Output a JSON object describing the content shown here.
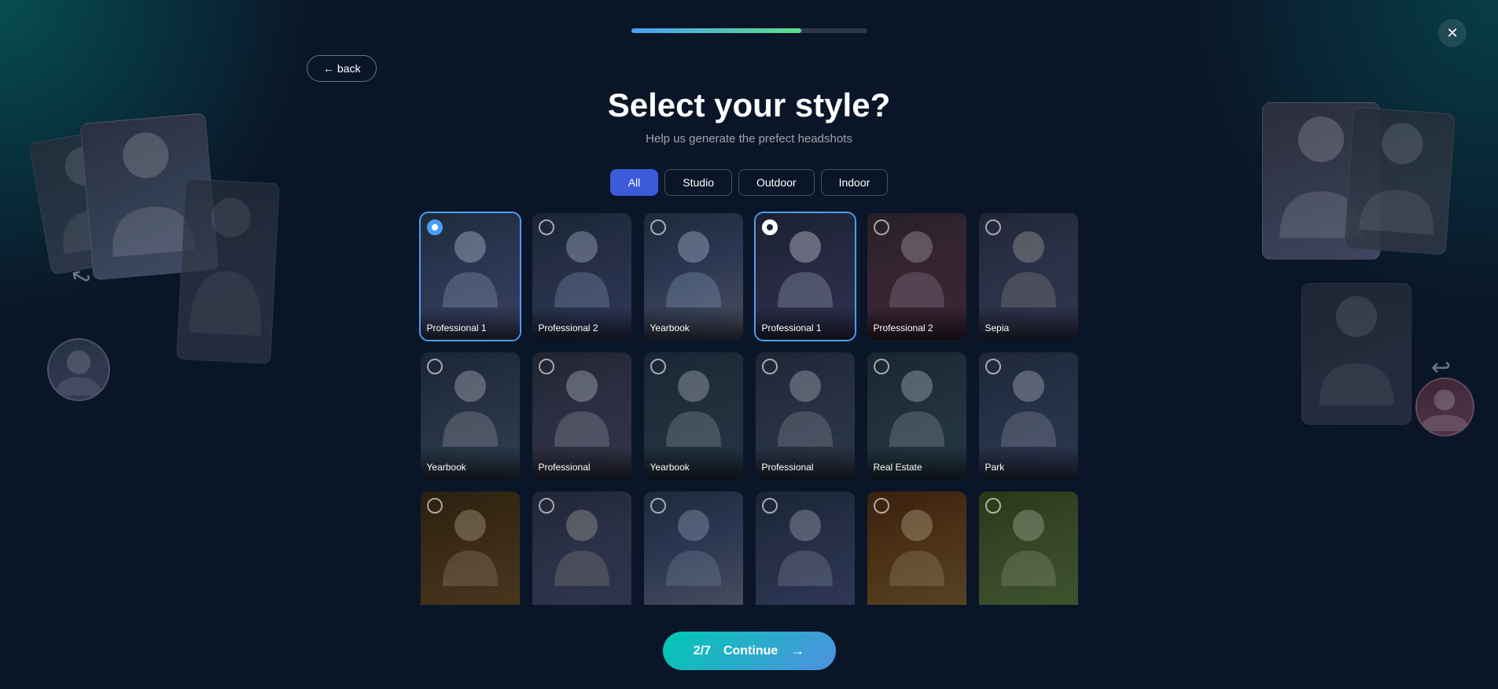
{
  "app": {
    "title": "Select your style?",
    "subtitle": "Help us generate the prefect headshots",
    "close_label": "✕",
    "back_label": "← back"
  },
  "progress": {
    "fill_percent": 72,
    "color_start": "#4a9ff5",
    "color_end": "#5dde8a"
  },
  "filters": {
    "tabs": [
      {
        "id": "all",
        "label": "All",
        "active": true
      },
      {
        "id": "studio",
        "label": "Studio",
        "active": false
      },
      {
        "id": "outdoor",
        "label": "Outdoor",
        "active": false
      },
      {
        "id": "indoor",
        "label": "Indoor",
        "active": false
      }
    ]
  },
  "styles": [
    {
      "id": 1,
      "label": "Professional 1",
      "row": 1,
      "selected": true,
      "radio": "blue",
      "bg": "card-bg-1"
    },
    {
      "id": 2,
      "label": "Professional 2",
      "row": 1,
      "selected": false,
      "radio": "none",
      "bg": "card-bg-2"
    },
    {
      "id": 3,
      "label": "Yearbook",
      "row": 1,
      "selected": false,
      "radio": "none",
      "bg": "card-bg-3"
    },
    {
      "id": 4,
      "label": "Professional 1",
      "row": 1,
      "selected": true,
      "radio": "white",
      "bg": "card-bg-4"
    },
    {
      "id": 5,
      "label": "Professional 2",
      "row": 1,
      "selected": false,
      "radio": "none",
      "bg": "card-bg-5"
    },
    {
      "id": 6,
      "label": "Sepia",
      "row": 1,
      "selected": false,
      "radio": "none",
      "bg": "card-bg-6"
    },
    {
      "id": 7,
      "label": "Yearbook",
      "row": 2,
      "selected": false,
      "radio": "none",
      "bg": "card-bg-7"
    },
    {
      "id": 8,
      "label": "Professional",
      "row": 2,
      "selected": false,
      "radio": "none",
      "bg": "card-bg-8"
    },
    {
      "id": 9,
      "label": "Yearbook",
      "row": 2,
      "selected": false,
      "radio": "none",
      "bg": "card-bg-9"
    },
    {
      "id": 10,
      "label": "Professional",
      "row": 2,
      "selected": false,
      "radio": "none",
      "bg": "card-bg-10"
    },
    {
      "id": 11,
      "label": "Real Estate",
      "row": 2,
      "selected": false,
      "radio": "none",
      "bg": "card-bg-11"
    },
    {
      "id": 12,
      "label": "Park",
      "row": 2,
      "selected": false,
      "radio": "none",
      "bg": "card-bg-12"
    },
    {
      "id": 13,
      "label": "",
      "row": 3,
      "selected": false,
      "radio": "none",
      "bg": "card-bg-13"
    },
    {
      "id": 14,
      "label": "",
      "row": 3,
      "selected": false,
      "radio": "none",
      "bg": "card-bg-6"
    },
    {
      "id": 15,
      "label": "",
      "row": 3,
      "selected": false,
      "radio": "none",
      "bg": "card-bg-3"
    },
    {
      "id": 16,
      "label": "",
      "row": 3,
      "selected": false,
      "radio": "none",
      "bg": "card-bg-2"
    },
    {
      "id": 17,
      "label": "",
      "row": 3,
      "selected": false,
      "radio": "none",
      "bg": "card-bg-13"
    },
    {
      "id": 18,
      "label": "",
      "row": 3,
      "selected": false,
      "radio": "none",
      "bg": "card-bg-14"
    }
  ],
  "continue_btn": {
    "counter": "2/7",
    "label": "Continue",
    "arrow": "→"
  }
}
